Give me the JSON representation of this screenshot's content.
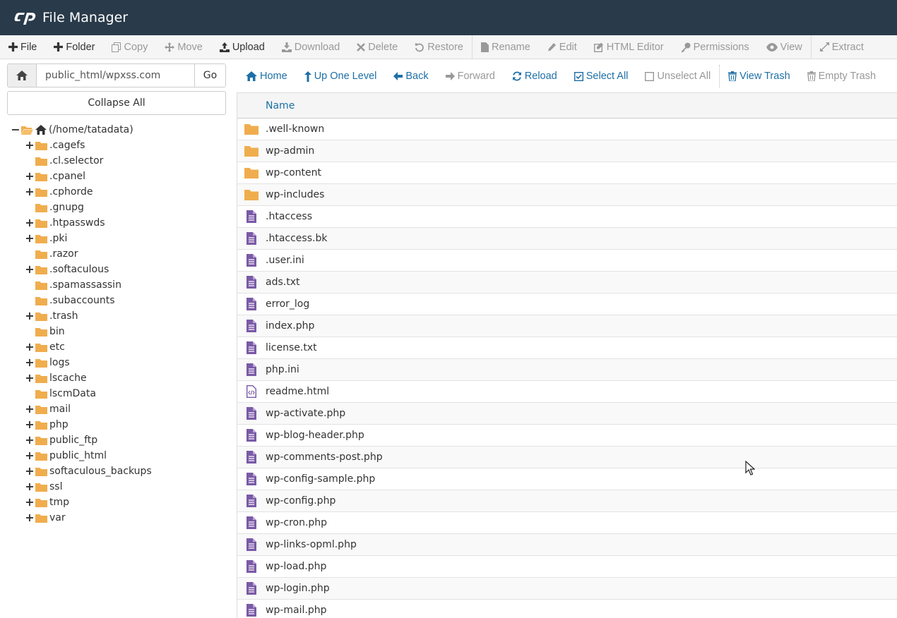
{
  "header": {
    "title": "File Manager",
    "logo": "cpanel-logo"
  },
  "toolbar": {
    "file": "File",
    "folder": "Folder",
    "copy": "Copy",
    "move": "Move",
    "upload": "Upload",
    "download": "Download",
    "delete": "Delete",
    "restore": "Restore",
    "rename": "Rename",
    "edit": "Edit",
    "html_editor": "HTML Editor",
    "permissions": "Permissions",
    "view": "View",
    "extract": "Extract"
  },
  "path": {
    "value": "public_html/wpxss.com",
    "go": "Go"
  },
  "collapse_all": "Collapse All",
  "tree": {
    "root": "(/home/tatadata)",
    "items": [
      {
        "name": ".cagefs",
        "expandable": true
      },
      {
        "name": ".cl.selector",
        "expandable": false
      },
      {
        "name": ".cpanel",
        "expandable": true
      },
      {
        "name": ".cphorde",
        "expandable": true
      },
      {
        "name": ".gnupg",
        "expandable": false
      },
      {
        "name": ".htpasswds",
        "expandable": true
      },
      {
        "name": ".pki",
        "expandable": true
      },
      {
        "name": ".razor",
        "expandable": false
      },
      {
        "name": ".softaculous",
        "expandable": true
      },
      {
        "name": ".spamassassin",
        "expandable": false
      },
      {
        "name": ".subaccounts",
        "expandable": false
      },
      {
        "name": ".trash",
        "expandable": true
      },
      {
        "name": "bin",
        "expandable": false
      },
      {
        "name": "etc",
        "expandable": true
      },
      {
        "name": "logs",
        "expandable": true
      },
      {
        "name": "lscache",
        "expandable": true
      },
      {
        "name": "lscmData",
        "expandable": false
      },
      {
        "name": "mail",
        "expandable": true
      },
      {
        "name": "php",
        "expandable": true
      },
      {
        "name": "public_ftp",
        "expandable": true
      },
      {
        "name": "public_html",
        "expandable": true
      },
      {
        "name": "softaculous_backups",
        "expandable": true
      },
      {
        "name": "ssl",
        "expandable": true
      },
      {
        "name": "tmp",
        "expandable": true
      },
      {
        "name": "var",
        "expandable": true
      }
    ]
  },
  "nav": {
    "home": "Home",
    "up_one_level": "Up One Level",
    "back": "Back",
    "forward": "Forward",
    "reload": "Reload",
    "select_all": "Select All",
    "unselect_all": "Unselect All",
    "view_trash": "View Trash",
    "empty_trash": "Empty Trash"
  },
  "table": {
    "column_name": "Name",
    "files": [
      {
        "name": ".well-known",
        "type": "folder"
      },
      {
        "name": "wp-admin",
        "type": "folder"
      },
      {
        "name": "wp-content",
        "type": "folder"
      },
      {
        "name": "wp-includes",
        "type": "folder"
      },
      {
        "name": ".htaccess",
        "type": "file"
      },
      {
        "name": ".htaccess.bk",
        "type": "file"
      },
      {
        "name": ".user.ini",
        "type": "file"
      },
      {
        "name": "ads.txt",
        "type": "file"
      },
      {
        "name": "error_log",
        "type": "file"
      },
      {
        "name": "index.php",
        "type": "file"
      },
      {
        "name": "license.txt",
        "type": "file"
      },
      {
        "name": "php.ini",
        "type": "file"
      },
      {
        "name": "readme.html",
        "type": "html"
      },
      {
        "name": "wp-activate.php",
        "type": "file"
      },
      {
        "name": "wp-blog-header.php",
        "type": "file"
      },
      {
        "name": "wp-comments-post.php",
        "type": "file"
      },
      {
        "name": "wp-config-sample.php",
        "type": "file"
      },
      {
        "name": "wp-config.php",
        "type": "file"
      },
      {
        "name": "wp-cron.php",
        "type": "file"
      },
      {
        "name": "wp-links-opml.php",
        "type": "file"
      },
      {
        "name": "wp-load.php",
        "type": "file"
      },
      {
        "name": "wp-login.php",
        "type": "file"
      },
      {
        "name": "wp-mail.php",
        "type": "file"
      }
    ]
  },
  "colors": {
    "header_bg": "#293a4a",
    "link": "#1d6fa5",
    "folder": "#f0ad4e",
    "file_icon": "#7a5aa6"
  }
}
